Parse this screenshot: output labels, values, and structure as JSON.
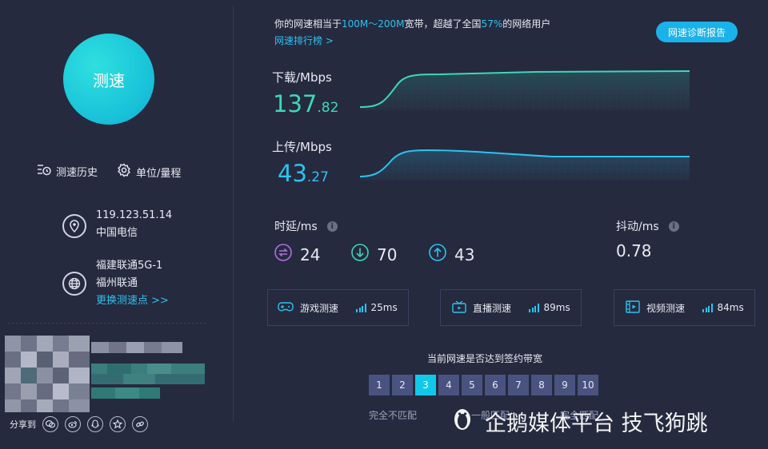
{
  "left": {
    "start_label": "测速",
    "history_label": "测速历史",
    "unit_label": "单位/量程",
    "ip": "119.123.51.14",
    "isp": "中国电信",
    "server_name": "福建联通5G-1",
    "server_city": "福州联通",
    "change_server": "更换测速点 >>",
    "share_label": "分享到"
  },
  "header": {
    "prefix": "你的网速相当于",
    "range": "100M～200M",
    "middle": "宽带，超越了全国",
    "percent": "57%",
    "suffix": "的网络用户",
    "ranking_link": "网速排行榜 >",
    "diagnose_button": "网速诊断报告"
  },
  "download": {
    "label": "下载/Mbps",
    "int": "137",
    "dec": ".82",
    "color": "#3cd8b8"
  },
  "upload": {
    "label": "上传/Mbps",
    "int": "43",
    "dec": ".27",
    "color": "#2bc3f0"
  },
  "latency": {
    "label": "时延/ms",
    "jitter_free": "24",
    "down": "70",
    "up": "43"
  },
  "jitter": {
    "label": "抖动/ms",
    "value": "0.78"
  },
  "cards": [
    {
      "label": "游戏测速",
      "value": "25ms"
    },
    {
      "label": "直播测速",
      "value": "89ms"
    },
    {
      "label": "视频测速",
      "value": "84ms"
    }
  ],
  "bandwidth": {
    "question": "当前网速是否达到签约带宽",
    "pages": [
      "1",
      "2",
      "3",
      "4",
      "5",
      "6",
      "7",
      "8",
      "9",
      "10"
    ],
    "active": "3",
    "scale_left": "完全不匹配",
    "scale_mid": "一般匹配",
    "scale_right": "完全匹配"
  },
  "watermark": {
    "text": "企鹅媒体平台 技飞狗跳"
  }
}
